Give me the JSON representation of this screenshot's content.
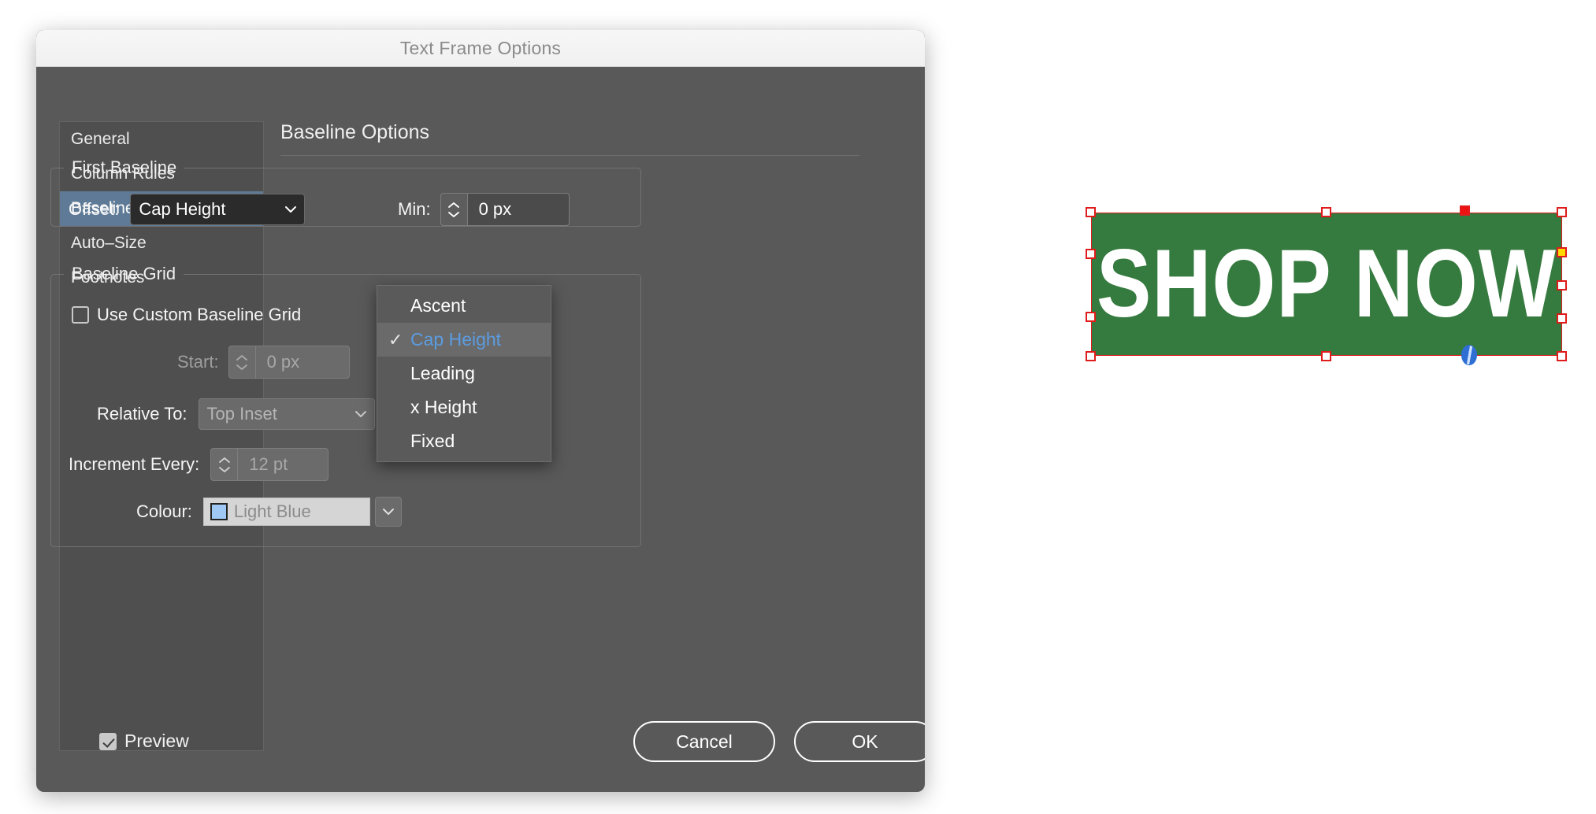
{
  "window": {
    "title": "Text Frame Options"
  },
  "sidebar": {
    "items": [
      {
        "label": "General",
        "selected": false
      },
      {
        "label": "Column Rules",
        "selected": false
      },
      {
        "label": "Baseline Options",
        "selected": true
      },
      {
        "label": "Auto–Size",
        "selected": false
      },
      {
        "label": "Footnotes",
        "selected": false
      }
    ]
  },
  "panel": {
    "title": "Baseline Options",
    "first_baseline": {
      "legend": "First Baseline",
      "offset_label": "Offset:",
      "offset_value": "Cap Height",
      "min_label": "Min:",
      "min_value": "0 px"
    },
    "baseline_grid": {
      "legend": "Baseline Grid",
      "use_checkbox_label": "Use Custom Baseline Grid",
      "use_checked": false,
      "start_label": "Start:",
      "start_value": "0 px",
      "relative_to_label": "Relative To:",
      "relative_to_value": "Top Inset",
      "increment_label": "Increment Every:",
      "increment_value": "12 pt",
      "colour_label": "Colour:",
      "colour_value": "Light Blue",
      "colour_hex": "#9fc8f5"
    }
  },
  "dropdown": {
    "open": true,
    "selected": "Cap Height",
    "check_glyph": "✓",
    "options": [
      {
        "label": "Ascent",
        "selected": false
      },
      {
        "label": "Cap Height",
        "selected": true
      },
      {
        "label": "Leading",
        "selected": false
      },
      {
        "label": "x Height",
        "selected": false
      },
      {
        "label": "Fixed",
        "selected": false
      }
    ]
  },
  "footer": {
    "preview_label": "Preview",
    "preview_checked": true,
    "cancel_label": "Cancel",
    "ok_label": "OK"
  },
  "artwork": {
    "text": "SHOP NOW",
    "fill_hex": "#357a3e",
    "text_hex": "#ffffff",
    "selection_hex": "#e01b1b",
    "anchor_hex": "#ffd900",
    "badge_label": "O"
  },
  "colors": {
    "dialog_bg": "#595959",
    "sidebar_selected": "#5e7a96",
    "accent_blue": "#5b9ce0"
  }
}
